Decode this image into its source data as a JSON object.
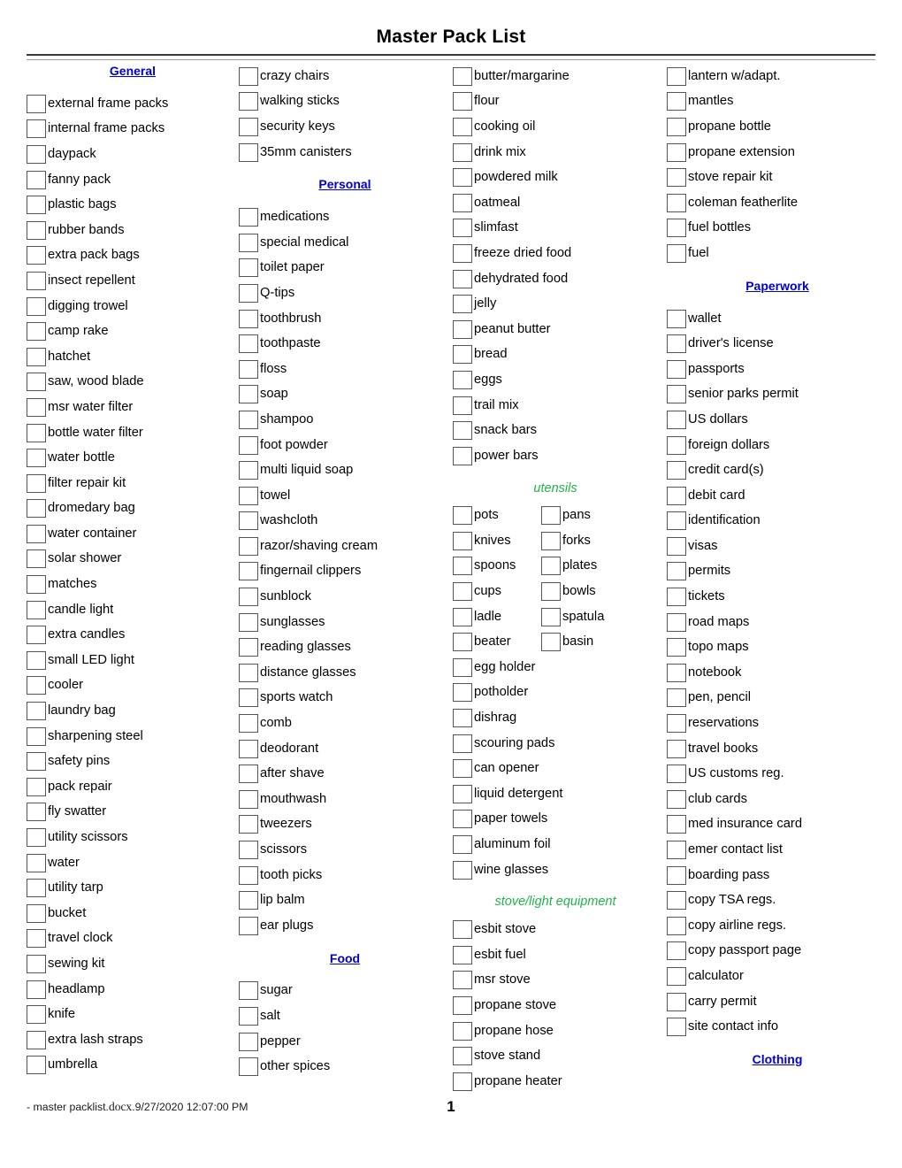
{
  "document": {
    "title": "Master Pack List"
  },
  "footer": {
    "file_prefix": "- master packlist.",
    "file_ext": "docx",
    "stamp": ".9/27/2020 12:07:00 PM",
    "page_number": "1"
  },
  "colors": {
    "heading_blue": "#0000c8",
    "subheading_green": "#22b24c",
    "checkbox_border": "#555555",
    "text": "#000000"
  },
  "columns": [
    {
      "id": "column-1",
      "blocks": [
        {
          "type": "heading",
          "label": "General",
          "style": "blue-underline",
          "items": [
            "external frame packs",
            "internal frame packs",
            "daypack",
            "fanny pack",
            "plastic bags",
            "rubber bands",
            "extra pack bags",
            "insect repellent",
            "digging trowel",
            "camp rake",
            "hatchet",
            "saw, wood blade",
            "msr water filter",
            "bottle water filter",
            "water bottle",
            "filter repair kit",
            "dromedary bag",
            "water container",
            "solar shower",
            "matches",
            "candle light",
            "extra candles",
            "small LED light",
            "cooler",
            "laundry bag",
            "sharpening steel",
            "safety pins",
            "pack repair",
            "fly swatter",
            "utility scissors",
            "water",
            "utility tarp",
            "bucket",
            "travel clock",
            "sewing kit",
            "headlamp",
            "knife",
            "extra lash straps",
            "umbrella"
          ]
        }
      ]
    },
    {
      "id": "column-2",
      "blocks": [
        {
          "type": "plain",
          "label": "",
          "style": "none",
          "items": [
            "crazy chairs",
            "walking sticks",
            "security keys",
            "35mm canisters"
          ]
        },
        {
          "type": "heading",
          "label": "Personal",
          "style": "blue-underline",
          "items": [
            "medications",
            "special medical",
            "toilet paper",
            "Q-tips",
            "toothbrush",
            "toothpaste",
            "floss",
            "soap",
            "shampoo",
            "foot powder",
            "multi liquid soap",
            "towel",
            "washcloth",
            "razor/shaving cream",
            "fingernail clippers",
            "sunblock",
            "sunglasses",
            "reading glasses",
            "distance glasses",
            "sports watch",
            "comb",
            "deodorant",
            "after shave",
            "mouthwash",
            "tweezers",
            "scissors",
            "tooth picks",
            "lip balm",
            "ear plugs"
          ]
        },
        {
          "type": "heading",
          "label": "Food",
          "style": "blue-underline",
          "items": [
            "sugar",
            "salt",
            "pepper",
            "other spices"
          ]
        }
      ]
    },
    {
      "id": "column-3",
      "blocks": [
        {
          "type": "plain",
          "label": "",
          "style": "none",
          "items": [
            "butter/margarine",
            "flour",
            "cooking oil",
            "drink mix",
            "powdered milk",
            "oatmeal",
            "slimfast",
            "freeze dried food",
            "dehydrated food",
            "jelly",
            "peanut butter",
            "bread",
            "eggs",
            "trail mix",
            "snack bars",
            "power bars"
          ]
        },
        {
          "type": "subheading-paired",
          "label": "utensils",
          "style": "green-italic",
          "pairs": [
            [
              "pots",
              "pans"
            ],
            [
              "knives",
              "forks"
            ],
            [
              "spoons",
              "plates"
            ],
            [
              "cups",
              "bowls"
            ],
            [
              "ladle",
              "spatula"
            ],
            [
              "beater",
              "basin"
            ]
          ],
          "items": [
            "egg holder",
            "potholder",
            "dishrag",
            "scouring pads",
            "can opener",
            "liquid detergent",
            "paper towels",
            "aluminum foil",
            "wine glasses"
          ]
        },
        {
          "type": "subheading",
          "label": "stove/light equipment",
          "style": "green-italic",
          "items": [
            "esbit stove",
            "esbit fuel",
            "msr stove",
            "propane stove",
            "propane hose",
            "stove stand",
            "propane heater"
          ]
        }
      ]
    },
    {
      "id": "column-4",
      "blocks": [
        {
          "type": "plain",
          "label": "",
          "style": "none",
          "items": [
            "lantern w/adapt.",
            "mantles",
            "propane bottle",
            "propane extension",
            "stove repair kit",
            "coleman featherlite",
            "fuel bottles",
            "fuel"
          ]
        },
        {
          "type": "heading",
          "label": "Paperwork",
          "style": "blue-underline",
          "items": [
            "wallet",
            "driver's license",
            "passports",
            "senior parks permit",
            "US dollars",
            "foreign dollars",
            "credit card(s)",
            "debit card",
            "identification",
            "visas",
            "permits",
            "tickets",
            "road maps",
            "topo maps",
            "notebook",
            "pen, pencil",
            "reservations",
            "travel books",
            "US customs reg.",
            "club cards",
            "med insurance card",
            "emer contact list",
            "boarding pass",
            "copy TSA regs.",
            "copy airline regs.",
            "copy passport page",
            "calculator",
            "carry permit",
            "site contact info"
          ]
        },
        {
          "type": "heading-only",
          "label": "Clothing",
          "style": "blue-underline",
          "items": []
        }
      ]
    }
  ]
}
